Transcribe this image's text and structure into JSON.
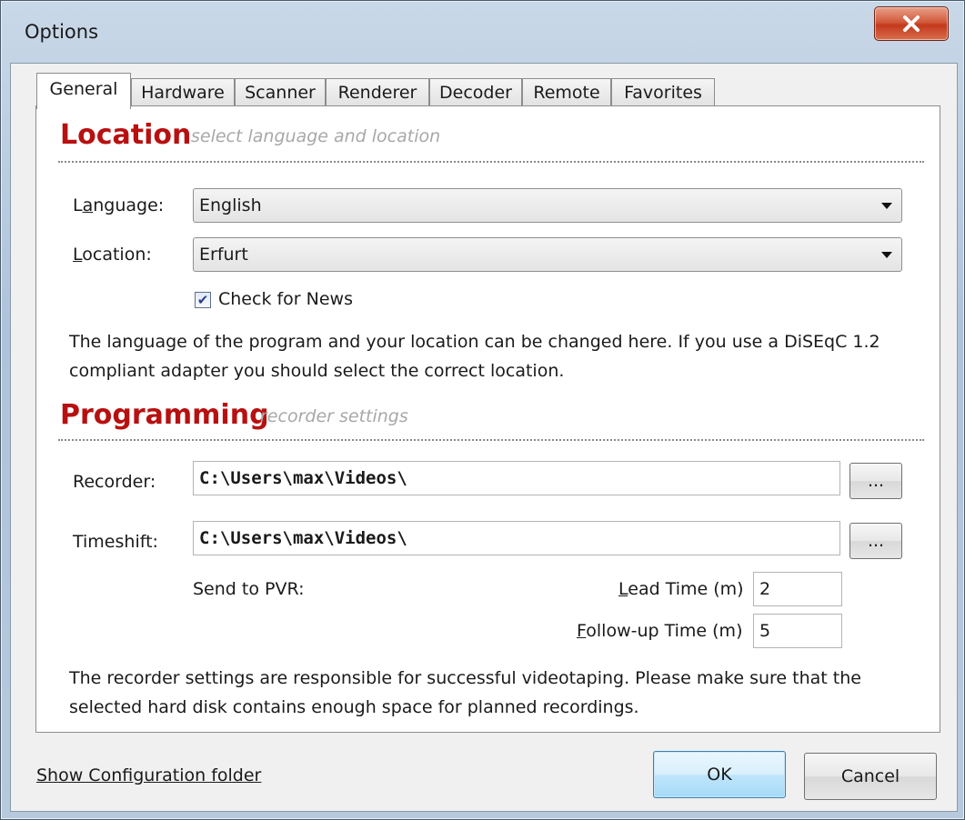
{
  "window": {
    "title": "Options"
  },
  "tabs": [
    "General",
    "Hardware",
    "Scanner",
    "Renderer",
    "Decoder",
    "Remote",
    "Favorites"
  ],
  "location": {
    "title": "Location",
    "subtitle": "select language and location",
    "language_label": "Language:",
    "language_value": "English",
    "location_label": "Location:",
    "location_value": "Erfurt",
    "check_news_label": "Check for News",
    "check_news_checked": true,
    "description_line1": "The language of the program and your location can be changed here. If you use a DiSEqC 1.2",
    "description_line2": "compliant adapter you should select the correct location."
  },
  "programming": {
    "title": "Programming",
    "subtitle": "recorder settings",
    "recorder_label": "Recorder:",
    "recorder_value": "C:\\Users\\max\\Videos\\",
    "timeshift_label": "Timeshift:",
    "timeshift_value": "C:\\Users\\max\\Videos\\",
    "browse_label": "...",
    "send_to_pvr_label": "Send to PVR:",
    "lead_time_label": "Lead Time (m)",
    "lead_time_value": "2",
    "followup_label": "Follow-up Time (m)",
    "followup_value": "5",
    "description_line1": "The recorder settings are responsible for successful videotaping. Please make sure that the",
    "description_line2": "selected hard disk contains enough space for planned recordings."
  },
  "footer": {
    "config_link": "Show Configuration folder",
    "ok_label": "OK",
    "cancel_label": "Cancel"
  },
  "icons": {
    "close": "close-icon",
    "dropdown": "chevron-down-icon",
    "check": "checkmark-icon"
  }
}
